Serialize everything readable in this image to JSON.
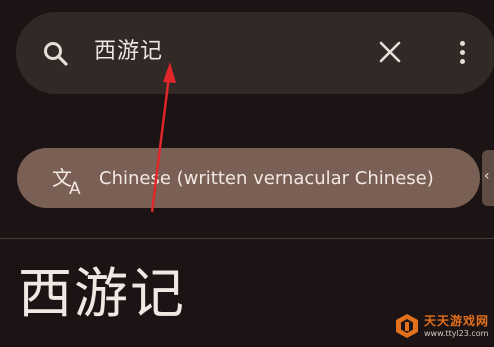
{
  "search": {
    "query": "西游记",
    "icons": {
      "search": "search-icon",
      "clear": "close-icon",
      "more": "more-vert-icon"
    }
  },
  "language_chip": {
    "label": "Chinese (written vernacular Chinese)",
    "icon": "translate-icon"
  },
  "article": {
    "title": "西游记"
  },
  "watermark": {
    "name": "天天游戏网",
    "url": "www.ttyl23.com"
  },
  "colors": {
    "background": "#1c1414",
    "search_bar": "#322826",
    "chip": "#7a5f55",
    "text": "#f1e7e3",
    "arrow": "#e0262a",
    "watermark_accent": "#e2701c"
  }
}
